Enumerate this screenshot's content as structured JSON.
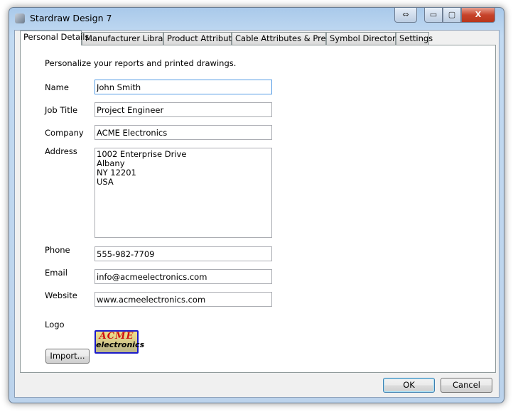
{
  "window": {
    "title": "Stardraw Design 7",
    "app_icon": "stardraw-icon",
    "buttons": {
      "resize": "⇔",
      "minimize": "▭",
      "maximize": "▢",
      "close": "X"
    }
  },
  "tabs": [
    {
      "label": "Personal Details",
      "active": true
    },
    {
      "label": "Manufacturer Libraries"
    },
    {
      "label": "Product Attributes"
    },
    {
      "label": "Cable Attributes & Presets"
    },
    {
      "label": "Symbol Directories"
    },
    {
      "label": "Settings"
    }
  ],
  "personal": {
    "intro": "Personalize your reports and printed drawings.",
    "name_label": "Name",
    "name": "John Smith",
    "job_label": "Job Title",
    "job": "Project Engineer",
    "company_label": "Company",
    "company": "ACME Electronics",
    "address_label": "Address",
    "address": "1002 Enterprise Drive\nAlbany\nNY 12201\nUSA",
    "phone_label": "Phone",
    "phone": "555-982-7709",
    "email_label": "Email",
    "email": "info@acmeelectronics.com",
    "website_label": "Website",
    "website": "www.acmeelectronics.com",
    "logo_label": "Logo",
    "logo_text_top": "ACME",
    "logo_text_bottom": "electronics",
    "import_label": "Import..."
  },
  "footer": {
    "ok": "OK",
    "cancel": "Cancel"
  }
}
